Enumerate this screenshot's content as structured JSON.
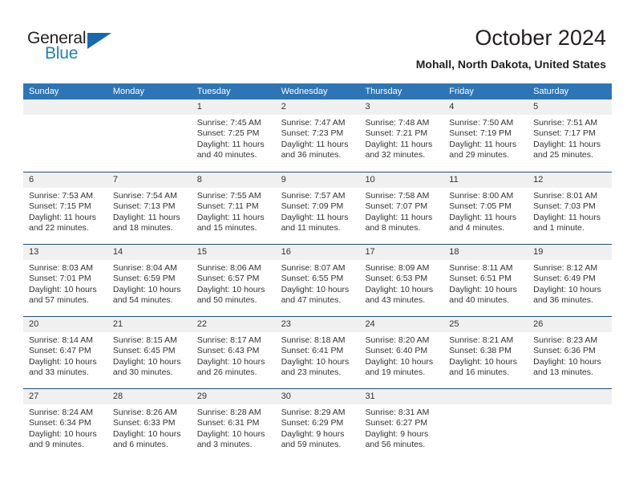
{
  "brand": {
    "name_part1": "General",
    "name_part2": "Blue",
    "triangle_icon": "triangle-logo-icon",
    "accent_color": "#1d7fc3"
  },
  "header": {
    "title": "October 2024",
    "location": "Mohall, North Dakota, United States",
    "header_bg_color": "#2e75b6",
    "row_divider_color": "#1f4e79",
    "date_band_color": "#f0f0f0"
  },
  "calendar": {
    "day_names": [
      "Sunday",
      "Monday",
      "Tuesday",
      "Wednesday",
      "Thursday",
      "Friday",
      "Saturday"
    ],
    "weeks": [
      [
        {
          "day": "",
          "lines": []
        },
        {
          "day": "",
          "lines": []
        },
        {
          "day": "1",
          "lines": [
            "Sunrise: 7:45 AM",
            "Sunset: 7:25 PM",
            "Daylight: 11 hours",
            "and 40 minutes."
          ]
        },
        {
          "day": "2",
          "lines": [
            "Sunrise: 7:47 AM",
            "Sunset: 7:23 PM",
            "Daylight: 11 hours",
            "and 36 minutes."
          ]
        },
        {
          "day": "3",
          "lines": [
            "Sunrise: 7:48 AM",
            "Sunset: 7:21 PM",
            "Daylight: 11 hours",
            "and 32 minutes."
          ]
        },
        {
          "day": "4",
          "lines": [
            "Sunrise: 7:50 AM",
            "Sunset: 7:19 PM",
            "Daylight: 11 hours",
            "and 29 minutes."
          ]
        },
        {
          "day": "5",
          "lines": [
            "Sunrise: 7:51 AM",
            "Sunset: 7:17 PM",
            "Daylight: 11 hours",
            "and 25 minutes."
          ]
        }
      ],
      [
        {
          "day": "6",
          "lines": [
            "Sunrise: 7:53 AM",
            "Sunset: 7:15 PM",
            "Daylight: 11 hours",
            "and 22 minutes."
          ]
        },
        {
          "day": "7",
          "lines": [
            "Sunrise: 7:54 AM",
            "Sunset: 7:13 PM",
            "Daylight: 11 hours",
            "and 18 minutes."
          ]
        },
        {
          "day": "8",
          "lines": [
            "Sunrise: 7:55 AM",
            "Sunset: 7:11 PM",
            "Daylight: 11 hours",
            "and 15 minutes."
          ]
        },
        {
          "day": "9",
          "lines": [
            "Sunrise: 7:57 AM",
            "Sunset: 7:09 PM",
            "Daylight: 11 hours",
            "and 11 minutes."
          ]
        },
        {
          "day": "10",
          "lines": [
            "Sunrise: 7:58 AM",
            "Sunset: 7:07 PM",
            "Daylight: 11 hours",
            "and 8 minutes."
          ]
        },
        {
          "day": "11",
          "lines": [
            "Sunrise: 8:00 AM",
            "Sunset: 7:05 PM",
            "Daylight: 11 hours",
            "and 4 minutes."
          ]
        },
        {
          "day": "12",
          "lines": [
            "Sunrise: 8:01 AM",
            "Sunset: 7:03 PM",
            "Daylight: 11 hours",
            "and 1 minute."
          ]
        }
      ],
      [
        {
          "day": "13",
          "lines": [
            "Sunrise: 8:03 AM",
            "Sunset: 7:01 PM",
            "Daylight: 10 hours",
            "and 57 minutes."
          ]
        },
        {
          "day": "14",
          "lines": [
            "Sunrise: 8:04 AM",
            "Sunset: 6:59 PM",
            "Daylight: 10 hours",
            "and 54 minutes."
          ]
        },
        {
          "day": "15",
          "lines": [
            "Sunrise: 8:06 AM",
            "Sunset: 6:57 PM",
            "Daylight: 10 hours",
            "and 50 minutes."
          ]
        },
        {
          "day": "16",
          "lines": [
            "Sunrise: 8:07 AM",
            "Sunset: 6:55 PM",
            "Daylight: 10 hours",
            "and 47 minutes."
          ]
        },
        {
          "day": "17",
          "lines": [
            "Sunrise: 8:09 AM",
            "Sunset: 6:53 PM",
            "Daylight: 10 hours",
            "and 43 minutes."
          ]
        },
        {
          "day": "18",
          "lines": [
            "Sunrise: 8:11 AM",
            "Sunset: 6:51 PM",
            "Daylight: 10 hours",
            "and 40 minutes."
          ]
        },
        {
          "day": "19",
          "lines": [
            "Sunrise: 8:12 AM",
            "Sunset: 6:49 PM",
            "Daylight: 10 hours",
            "and 36 minutes."
          ]
        }
      ],
      [
        {
          "day": "20",
          "lines": [
            "Sunrise: 8:14 AM",
            "Sunset: 6:47 PM",
            "Daylight: 10 hours",
            "and 33 minutes."
          ]
        },
        {
          "day": "21",
          "lines": [
            "Sunrise: 8:15 AM",
            "Sunset: 6:45 PM",
            "Daylight: 10 hours",
            "and 30 minutes."
          ]
        },
        {
          "day": "22",
          "lines": [
            "Sunrise: 8:17 AM",
            "Sunset: 6:43 PM",
            "Daylight: 10 hours",
            "and 26 minutes."
          ]
        },
        {
          "day": "23",
          "lines": [
            "Sunrise: 8:18 AM",
            "Sunset: 6:41 PM",
            "Daylight: 10 hours",
            "and 23 minutes."
          ]
        },
        {
          "day": "24",
          "lines": [
            "Sunrise: 8:20 AM",
            "Sunset: 6:40 PM",
            "Daylight: 10 hours",
            "and 19 minutes."
          ]
        },
        {
          "day": "25",
          "lines": [
            "Sunrise: 8:21 AM",
            "Sunset: 6:38 PM",
            "Daylight: 10 hours",
            "and 16 minutes."
          ]
        },
        {
          "day": "26",
          "lines": [
            "Sunrise: 8:23 AM",
            "Sunset: 6:36 PM",
            "Daylight: 10 hours",
            "and 13 minutes."
          ]
        }
      ],
      [
        {
          "day": "27",
          "lines": [
            "Sunrise: 8:24 AM",
            "Sunset: 6:34 PM",
            "Daylight: 10 hours",
            "and 9 minutes."
          ]
        },
        {
          "day": "28",
          "lines": [
            "Sunrise: 8:26 AM",
            "Sunset: 6:33 PM",
            "Daylight: 10 hours",
            "and 6 minutes."
          ]
        },
        {
          "day": "29",
          "lines": [
            "Sunrise: 8:28 AM",
            "Sunset: 6:31 PM",
            "Daylight: 10 hours",
            "and 3 minutes."
          ]
        },
        {
          "day": "30",
          "lines": [
            "Sunrise: 8:29 AM",
            "Sunset: 6:29 PM",
            "Daylight: 9 hours",
            "and 59 minutes."
          ]
        },
        {
          "day": "31",
          "lines": [
            "Sunrise: 8:31 AM",
            "Sunset: 6:27 PM",
            "Daylight: 9 hours",
            "and 56 minutes."
          ]
        },
        {
          "day": "",
          "lines": []
        },
        {
          "day": "",
          "lines": []
        }
      ]
    ]
  }
}
